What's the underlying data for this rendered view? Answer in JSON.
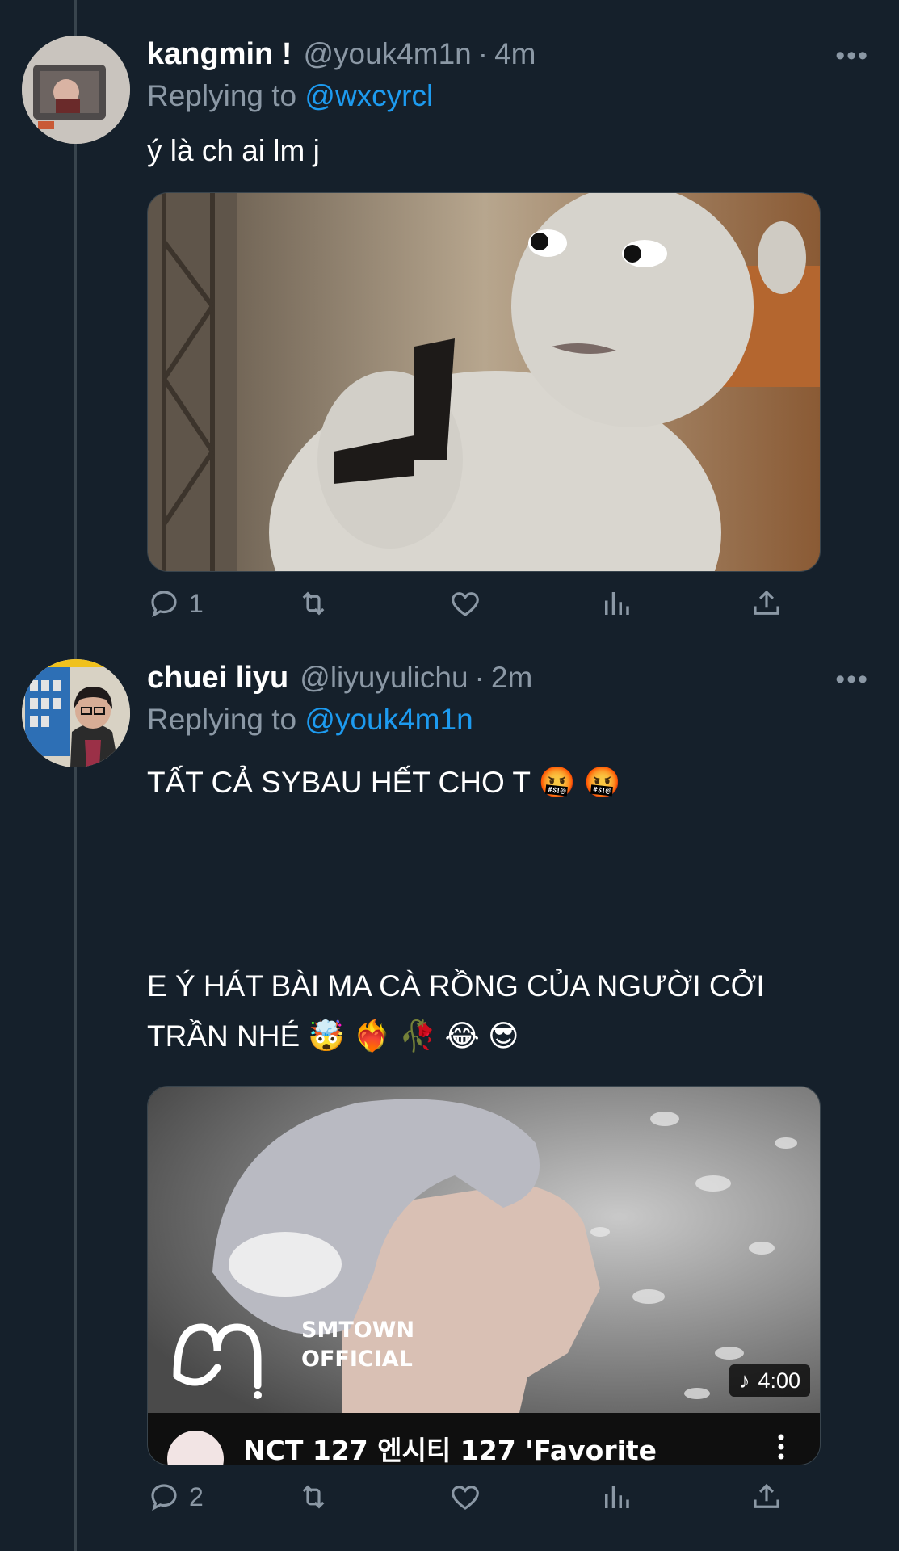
{
  "tweets": [
    {
      "name": "kangmin !",
      "handle": "@youk4m1n",
      "time": "4m",
      "replying_label": "Replying to",
      "replying_to": "@wxcyrcl",
      "text": "ý là ch ai lm j",
      "reply_count": "1",
      "more_icon": "more-icon"
    },
    {
      "name": "chuei liyu",
      "handle": "@liyuyulichu",
      "time": "2m",
      "replying_label": "Replying to",
      "replying_to": "@youk4m1n",
      "text_line1": "TẤT CẢ SYBAU HẾT CHO T 🤬 🤬",
      "text_line2": "E Ý HÁT BÀI MA CÀ RỒNG CỦA NGƯỜI CỞI",
      "text_line3": "TRẦN NHÉ 🤯 ❤️‍🔥 🥀 😂 😎",
      "video": {
        "channel_line1": "SMTOWN",
        "channel_line2": "OFFICIAL",
        "duration": "4:00",
        "title": "NCT 127 엔시티 127 'Favorite"
      },
      "reply_count": "2"
    }
  ],
  "separator": "·"
}
